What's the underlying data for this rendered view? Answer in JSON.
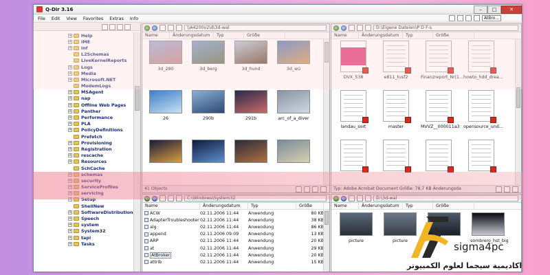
{
  "window": {
    "title": "Q-Dir 3.16"
  },
  "menu": [
    "File",
    "Edit",
    "View",
    "Favorites",
    "Extras",
    "Info"
  ],
  "menu_right": {
    "lang": "AtBro..."
  },
  "tree": {
    "items": [
      {
        "label": "Help",
        "exp": "+"
      },
      {
        "label": "IME",
        "exp": "+"
      },
      {
        "label": "inf",
        "exp": "+"
      },
      {
        "label": "L2Schemas",
        "exp": ""
      },
      {
        "label": "LiveKernelReports",
        "exp": ""
      },
      {
        "label": "Logs",
        "exp": "+"
      },
      {
        "label": "Media",
        "exp": "+"
      },
      {
        "label": "Microsoft.NET",
        "exp": "+"
      },
      {
        "label": "ModemLogs",
        "exp": ""
      },
      {
        "label": "MSAgent",
        "exp": "+"
      },
      {
        "label": "nap",
        "exp": "+"
      },
      {
        "label": "Offline Web Pages",
        "exp": "+"
      },
      {
        "label": "Panther",
        "exp": "+"
      },
      {
        "label": "Performance",
        "exp": "+"
      },
      {
        "label": "PLA",
        "exp": "+"
      },
      {
        "label": "PolicyDefinitions",
        "exp": "+"
      },
      {
        "label": "Prefetch",
        "exp": ""
      },
      {
        "label": "Provisioning",
        "exp": "+"
      },
      {
        "label": "Registration",
        "exp": "+"
      },
      {
        "label": "rescache",
        "exp": "+"
      },
      {
        "label": "Resources",
        "exp": "+"
      },
      {
        "label": "SchCache",
        "exp": ""
      },
      {
        "label": "schemas",
        "exp": "+"
      },
      {
        "label": "security",
        "exp": "+"
      },
      {
        "label": "ServiceProfiles",
        "exp": "+"
      },
      {
        "label": "servicing",
        "exp": "+"
      },
      {
        "label": "Setup",
        "exp": "+"
      },
      {
        "label": "ShellNew",
        "exp": ""
      },
      {
        "label": "SoftwareDistribution",
        "exp": "+"
      },
      {
        "label": "Speech",
        "exp": "+"
      },
      {
        "label": "system",
        "exp": "+"
      },
      {
        "label": "System32",
        "exp": "+"
      },
      {
        "label": "tapi",
        "exp": "+"
      },
      {
        "label": "Tasks",
        "exp": "+"
      }
    ]
  },
  "pane_tl": {
    "path": "\\\\A4200v2\\d\\3d-wal",
    "columns": [
      "Name",
      "Änderungsdatum",
      "Typ",
      "Größe"
    ],
    "status": "41 Objects",
    "thumbs": [
      {
        "name": "3d_280",
        "colors": [
          "#9bb0d8",
          "#c78a8a"
        ]
      },
      {
        "name": "3d_berg",
        "colors": [
          "#7fa0c8",
          "#6a7a5a"
        ]
      },
      {
        "name": "3d_hund",
        "colors": [
          "#b8c7d8",
          "#6c4f3a"
        ]
      },
      {
        "name": "3d_wü",
        "colors": [
          "#5a80c0",
          "#d29b5a"
        ]
      },
      {
        "name": "26",
        "colors": [
          "#3e7ec8",
          "#c7e0f0"
        ]
      },
      {
        "name": "290b",
        "colors": [
          "#8ab0d8",
          "#2e4a70"
        ]
      },
      {
        "name": "291b",
        "colors": [
          "#2a2a4a",
          "#c86a6a"
        ]
      },
      {
        "name": "arc_of_a_diver",
        "colors": [
          "#8894a4",
          "#d0d8e0"
        ]
      },
      {
        "name": "",
        "colors": [
          "#1a1a3a",
          "#d8a040"
        ]
      },
      {
        "name": "",
        "colors": [
          "#0e1a3a",
          "#6090d0"
        ]
      },
      {
        "name": "",
        "colors": [
          "#2a2a3a",
          "#b07040"
        ]
      },
      {
        "name": "",
        "colors": [
          "#7a8a9a",
          "#d8d0b0"
        ]
      }
    ]
  },
  "pane_tr": {
    "path": "D:\\Eigene Dateien\\P D F-s",
    "columns": [
      "Name",
      "Änderungsdatum",
      "Typ",
      "Größe"
    ],
    "status": "Typ: Adobe Acrobat Document Größe: 78,7 KB Änderungsda",
    "docs": [
      {
        "name": "DVX_538",
        "cover": "#e0407a"
      },
      {
        "name": "e811_tusf2",
        "cover": ""
      },
      {
        "name": "Finanzreport_Nr|1...",
        "cover": ""
      },
      {
        "name": "howto_hdd_drea...",
        "cover": ""
      },
      {
        "name": "landau_sort",
        "cover": ""
      },
      {
        "name": "master",
        "cover": ""
      },
      {
        "name": "MVVZ__000011a3",
        "cover": ""
      },
      {
        "name": "opensource_und...",
        "cover": ""
      },
      {
        "name": "",
        "cover": ""
      },
      {
        "name": "",
        "cover": ""
      },
      {
        "name": "",
        "cover": ""
      },
      {
        "name": "",
        "cover": ""
      }
    ]
  },
  "pane_bl": {
    "path": "C:\\Windows\\System32",
    "columns": [
      "Name",
      "Änderungsdatum",
      "Typ",
      "Größe"
    ],
    "rows": [
      {
        "name": "ACW",
        "date": "02.11.2006 11:44",
        "type": "Anwendung",
        "size": "80 KB"
      },
      {
        "name": "AdapterTroubleshooter",
        "date": "02.11.2006 11:44",
        "type": "Anwendung",
        "size": "38 KB"
      },
      {
        "name": "alg",
        "date": "02.11.2006 11:44",
        "type": "Anwendung",
        "size": "86 KB"
      },
      {
        "name": "append",
        "date": "02.11.2006 09:09",
        "type": "Anwendung",
        "size": "13 KB"
      },
      {
        "name": "ARP",
        "date": "02.11.2006 11:44",
        "type": "Anwendung",
        "size": "20 KB"
      },
      {
        "name": "at",
        "date": "02.11.2006 11:44",
        "type": "Anwendung",
        "size": "29 KB"
      },
      {
        "name": "AtBroker",
        "date": "02.11.2006 11:44",
        "type": "Anwendung",
        "size": "20 KB"
      },
      {
        "name": "attrib",
        "date": "02.11.2006 11:44",
        "type": "Anwendung",
        "size": "15 KB"
      }
    ]
  },
  "pane_br": {
    "path": "D:\\3d-wal",
    "columns": [
      "Name",
      "Änderungsdatum",
      "Typ",
      "Größe"
    ],
    "thumbs": [
      {
        "name": "picture",
        "colors": [
          "#5a6a7a",
          "#2a2f38"
        ]
      },
      {
        "name": "picture",
        "colors": [
          "#6a7888",
          "#3a3f48"
        ]
      },
      {
        "name": "",
        "colors": [
          "#4a5868",
          "#1a1f28"
        ]
      },
      {
        "name": "sombrero_hst_big",
        "colors": [
          "#0a0a14",
          "#c8c8d0"
        ]
      }
    ]
  },
  "overlay": {
    "brand": "sigma4pc",
    "arabic": "اكاديمية سيجما لعلوم الكمبيوتر"
  }
}
